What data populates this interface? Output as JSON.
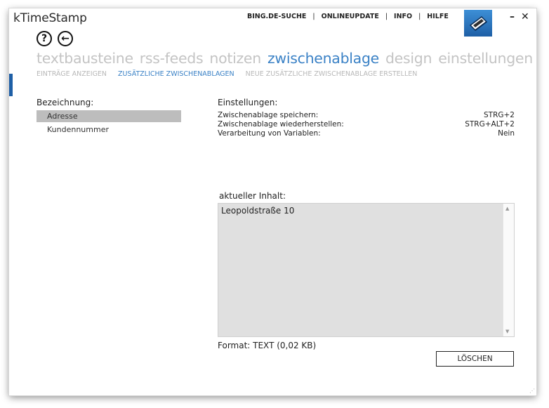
{
  "app": {
    "title": "kTimeStamp"
  },
  "topnav": {
    "items": [
      "BING.DE-SUCHE",
      "ONLINEUPDATE",
      "INFO",
      "HILFE"
    ]
  },
  "window_controls": {
    "minimize": "–",
    "close": "✕"
  },
  "nav_icons": {
    "help": "?",
    "back": "←"
  },
  "tabs": [
    "textbausteine",
    "rss-feeds",
    "notizen",
    "zwischenablage",
    "design",
    "einstellungen"
  ],
  "subtabs": [
    "EINTRÄGE ANZEIGEN",
    "ZUSÄTZLICHE ZWISCHENABLAGEN",
    "NEUE ZUSÄTZLICHE ZWISCHENABLAGE ERSTELLEN"
  ],
  "left": {
    "heading": "Bezeichnung:",
    "items": [
      "Adresse",
      "Kundennummer"
    ]
  },
  "settings": {
    "heading": "Einstellungen:",
    "rows": [
      {
        "label": "Zwischenablage speichern:",
        "value": "STRG+2"
      },
      {
        "label": "Zwischenablage wiederherstellen:",
        "value": "STRG+ALT+2"
      },
      {
        "label": "Verarbeitung von Variablen:",
        "value": "Nein"
      }
    ]
  },
  "content": {
    "heading": "aktueller Inhalt:",
    "text": "Leopoldstraße 10",
    "format": "Format: TEXT (0,02 KB)"
  },
  "buttons": {
    "delete": "LÖSCHEN"
  },
  "colors": {
    "accent": "#3b82c6",
    "brand": "#1e5fa6"
  }
}
